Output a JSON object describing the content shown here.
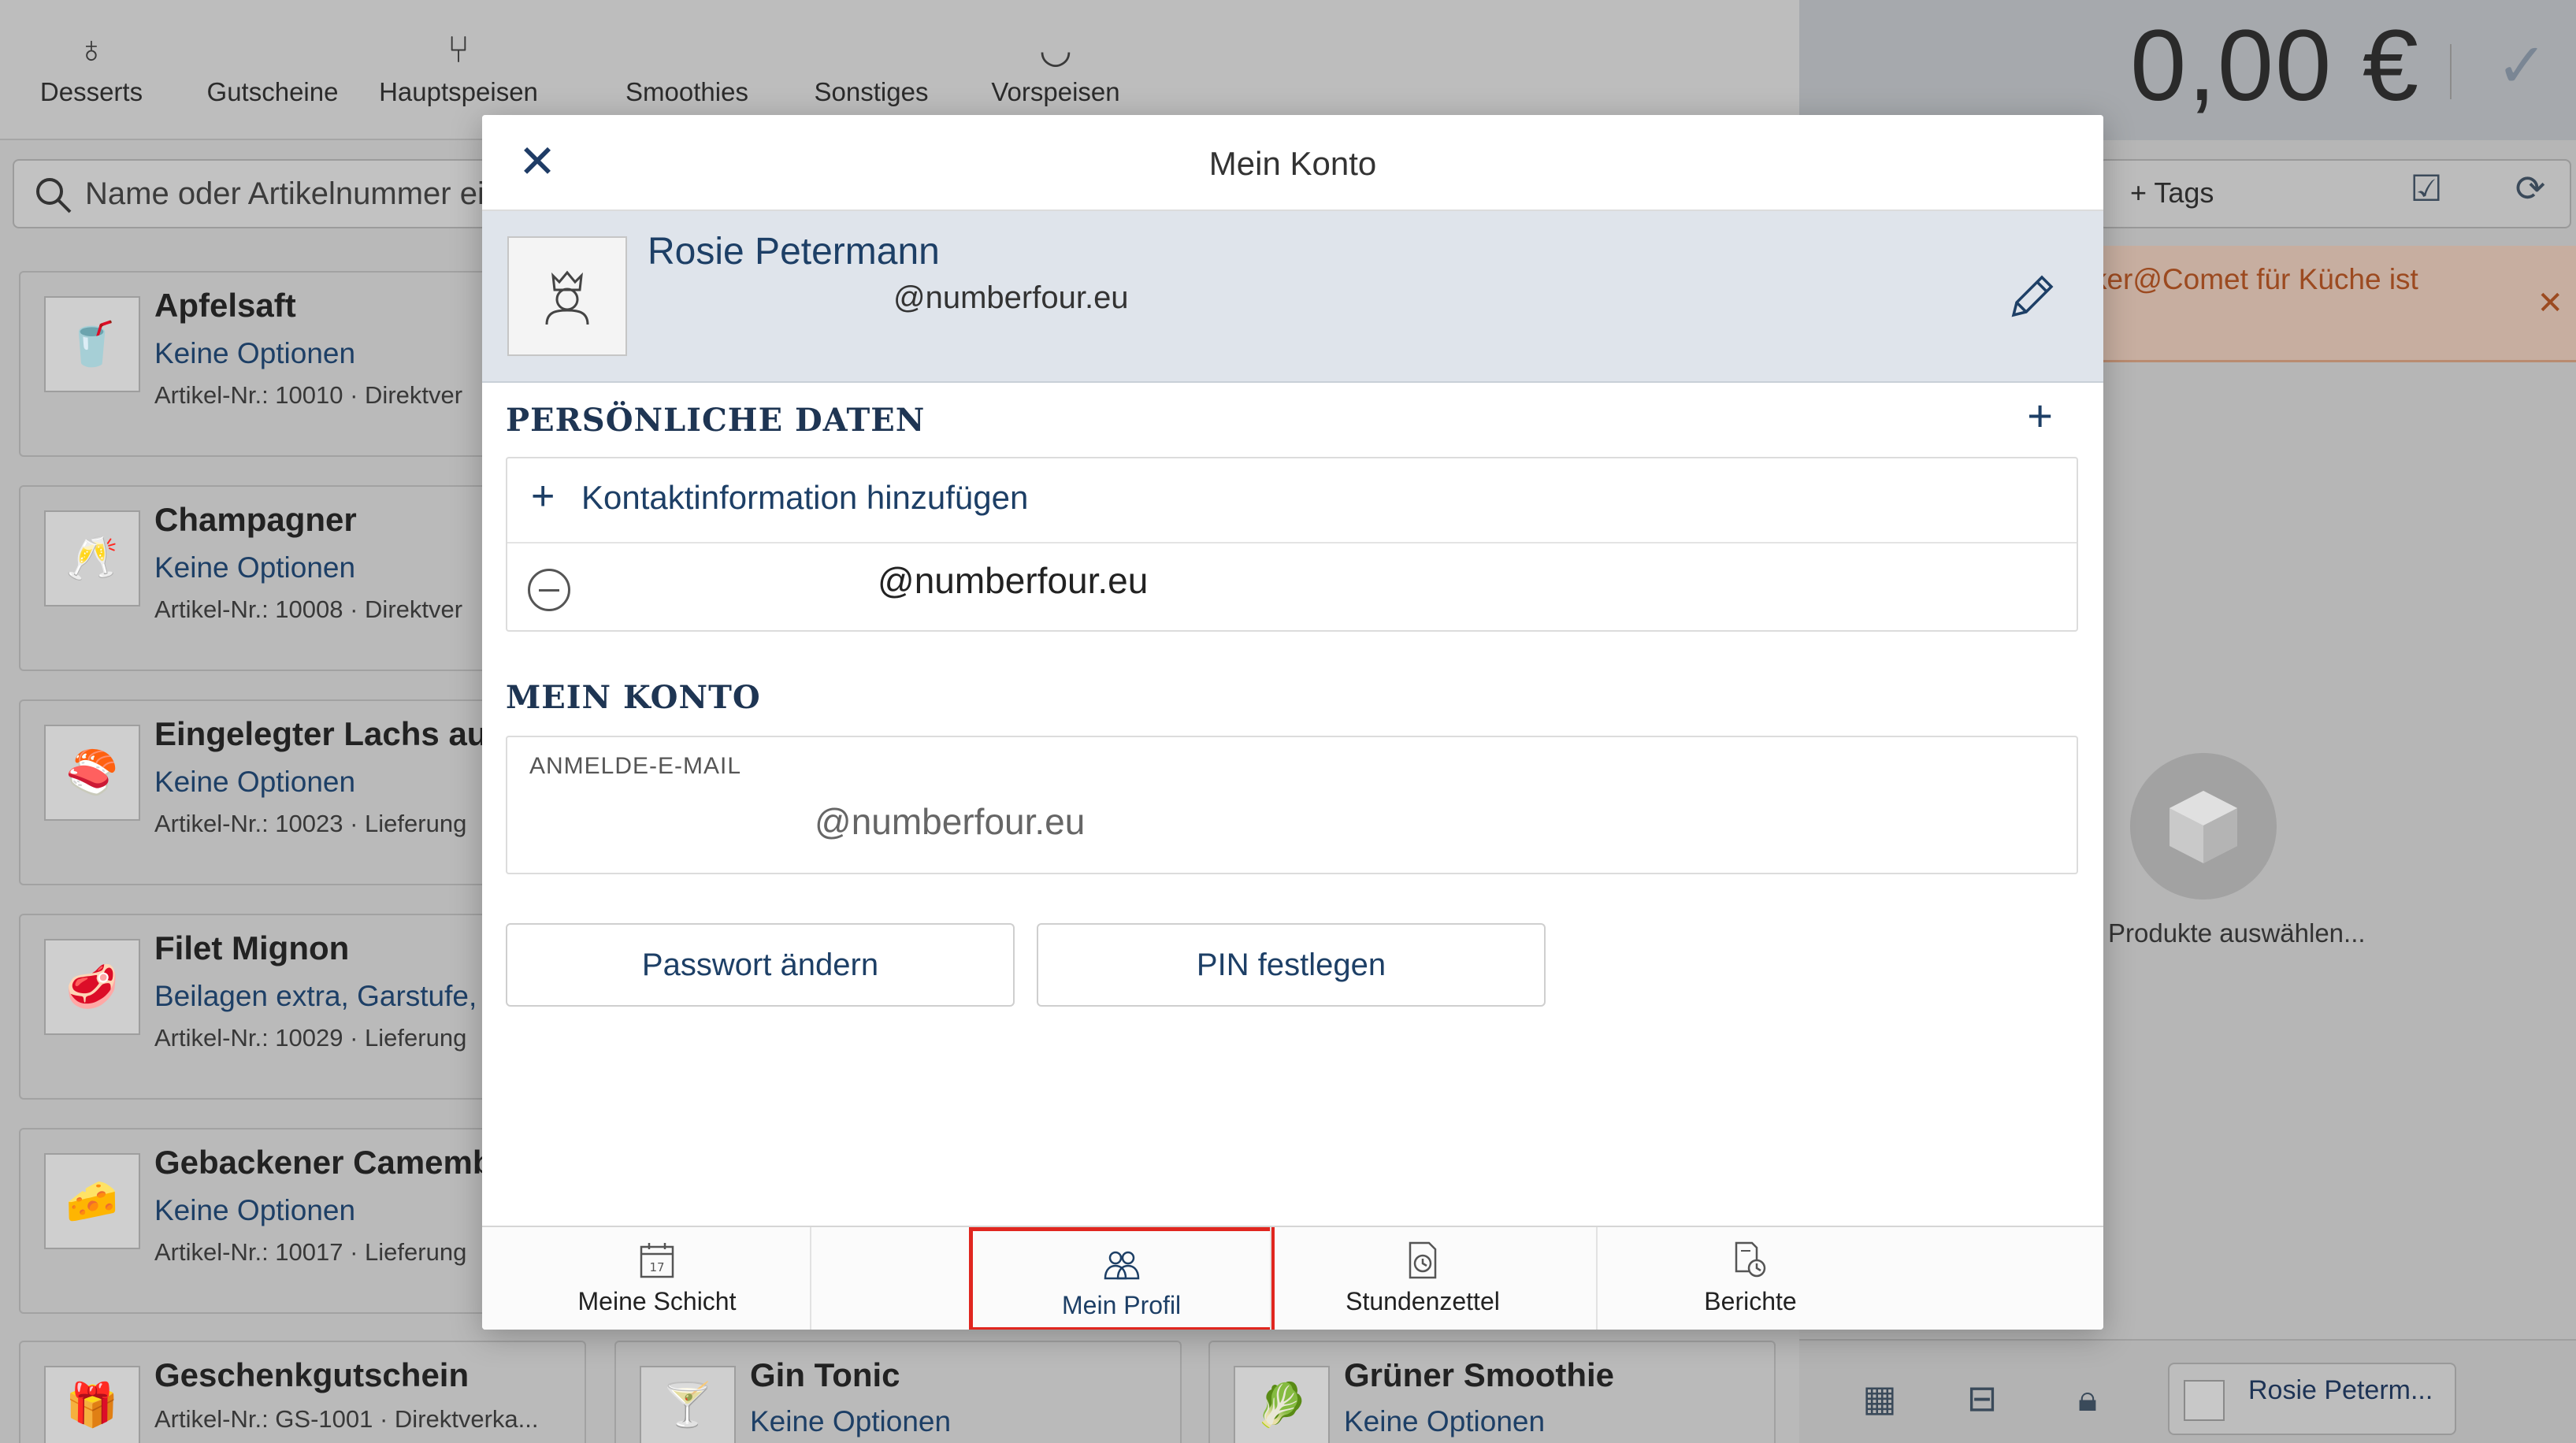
{
  "categories": [
    {
      "label": "Desserts",
      "icon": "dessert-icon"
    },
    {
      "label": "Gutscheine",
      "icon": "voucher-icon"
    },
    {
      "label": "Hauptspeisen",
      "icon": "cutlery-icon"
    },
    {
      "label": "Smoothies",
      "icon": "smoothie-icon"
    },
    {
      "label": "Sonstiges",
      "icon": "misc-icon"
    },
    {
      "label": "Vorspeisen",
      "icon": "bowl-icon"
    }
  ],
  "search": {
    "placeholder": "Name oder Artikelnummer ei"
  },
  "products": [
    {
      "name": "Apfelsaft",
      "options": "Keine Optionen",
      "meta": "Artikel-Nr.: 10010 · Direktver"
    },
    {
      "name": "Champagner",
      "options": "Keine Optionen",
      "meta": "Artikel-Nr.: 10008 · Direktver"
    },
    {
      "name": "Eingelegter Lachs auf B",
      "options": "Keine Optionen",
      "meta": "Artikel-Nr.: 10023 · Lieferung"
    },
    {
      "name": "Filet Mignon",
      "options": "Beilagen extra, Garstufe, S",
      "meta": "Artikel-Nr.: 10029 · Lieferung"
    },
    {
      "name": "Gebackener Camember",
      "options": "Keine Optionen",
      "meta": "Artikel-Nr.: 10017 · Lieferung"
    },
    {
      "name": "Geschenkgutschein",
      "options": "",
      "meta": "Artikel-Nr.: GS-1001 · Direktverka..."
    },
    {
      "name": "Gin Tonic",
      "options": "Keine Optionen",
      "meta": ""
    },
    {
      "name": "Grüner Smoothie",
      "options": "Keine Optionen",
      "meta": ""
    }
  ],
  "cart": {
    "total": "0,00 €",
    "tags_label": "+  Tags",
    "alert": "drucker@Comet für Küche ist",
    "empty_text": "Produkte auswählen...",
    "user": "Rosie Peterm..."
  },
  "modal": {
    "title": "Mein Konto",
    "profile_name": "Rosie Petermann",
    "profile_email": "@numberfour.eu",
    "personal_section": "PERSÖNLICHE DATEN",
    "add_contact": "Kontaktinformation hinzufügen",
    "contact_email": "@numberfour.eu",
    "account_section": "MEIN KONTO",
    "login_label": "ANMELDE-E-MAIL",
    "login_email": "@numberfour.eu",
    "btn_password": "Passwort ändern",
    "btn_pin": "PIN festlegen",
    "tabs": [
      {
        "label": "Meine Schicht",
        "active": false
      },
      {
        "label": "Mein Profil",
        "active": true
      },
      {
        "label": "Stundenzettel",
        "active": false
      },
      {
        "label": "Berichte",
        "active": false
      }
    ],
    "calendar_day": "17"
  },
  "colors": {
    "accent": "#1d3f66",
    "active_tab_border": "#e0261f",
    "alert_text": "#9c4a20"
  }
}
